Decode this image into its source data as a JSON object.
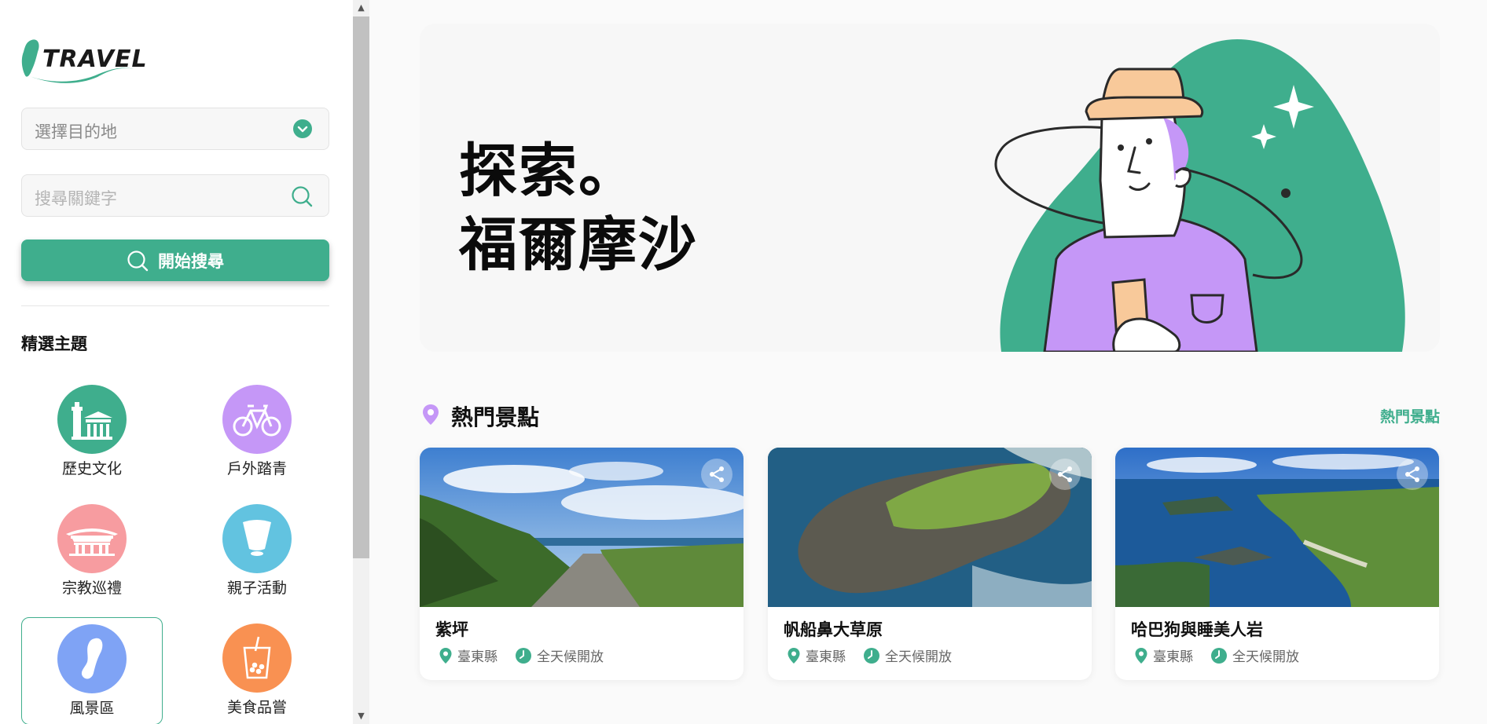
{
  "brand": {
    "logo_text": "TRAVEL"
  },
  "search": {
    "destination_placeholder": "選擇目的地",
    "keyword_placeholder": "搜尋關鍵字",
    "button_label": "開始搜尋"
  },
  "themes": {
    "title": "精選主題",
    "items": [
      {
        "label": "歷史文化",
        "color": "#3fae8d",
        "icon": "temple-tower-icon"
      },
      {
        "label": "戶外踏青",
        "color": "#c597f7",
        "icon": "bicycle-icon"
      },
      {
        "label": "宗教巡禮",
        "color": "#f79ca0",
        "icon": "shrine-icon"
      },
      {
        "label": "親子活動",
        "color": "#62c3e0",
        "icon": "lantern-icon"
      },
      {
        "label": "風景區",
        "color": "#7fa3f5",
        "icon": "taiwan-map-icon",
        "selected": true
      },
      {
        "label": "美食品嘗",
        "color": "#f99152",
        "icon": "bubble-tea-icon"
      }
    ]
  },
  "hero": {
    "line1": "探索。",
    "line2": "福爾摩沙"
  },
  "popular": {
    "title": "熱門景點",
    "more_link": "熱門景點",
    "cards": [
      {
        "name": "紫坪",
        "county": "臺東縣",
        "hours": "全天候開放"
      },
      {
        "name": "帆船鼻大草原",
        "county": "臺東縣",
        "hours": "全天候開放"
      },
      {
        "name": "哈巴狗與睡美人岩",
        "county": "臺東縣",
        "hours": "全天候開放"
      }
    ]
  },
  "colors": {
    "accent": "#3fae8d",
    "purple": "#c597f7"
  }
}
